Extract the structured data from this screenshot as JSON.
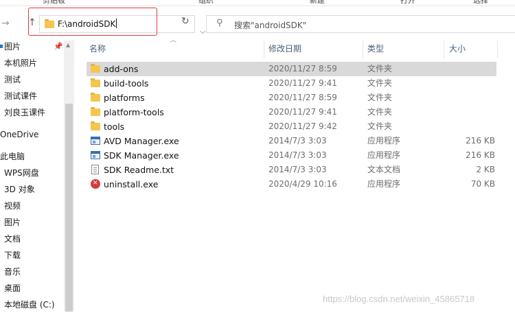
{
  "ribbon": {
    "items": [
      "剪贴板",
      "组织",
      "新建",
      "打开",
      "选择"
    ]
  },
  "nav": {
    "back": "→",
    "up": "↑"
  },
  "address": {
    "path": "F:\\androidSDK"
  },
  "search": {
    "placeholder": "搜索\"androidSDK\""
  },
  "sidebar": {
    "items": [
      {
        "label": "图片",
        "pinned": true
      },
      {
        "label": "本机照片"
      },
      {
        "label": "测试"
      },
      {
        "label": "测试课件"
      },
      {
        "label": "刘良玉课件"
      },
      {
        "label": "OneDrive"
      },
      {
        "label": "此电脑"
      },
      {
        "label": "WPS网盘"
      },
      {
        "label": "3D 对象"
      },
      {
        "label": "视频"
      },
      {
        "label": "图片"
      },
      {
        "label": "文档"
      },
      {
        "label": "下载"
      },
      {
        "label": "音乐"
      },
      {
        "label": "桌面"
      },
      {
        "label": "本地磁盘 (C:)"
      }
    ]
  },
  "columns": {
    "name": "名称",
    "date": "修改日期",
    "type": "类型",
    "size": "大小"
  },
  "files": [
    {
      "name": "add-ons",
      "date": "2020/11/27 8:59",
      "type": "文件夹",
      "size": "",
      "icon": "folder",
      "selected": true
    },
    {
      "name": "build-tools",
      "date": "2020/11/27 9:41",
      "type": "文件夹",
      "size": "",
      "icon": "folder"
    },
    {
      "name": "platforms",
      "date": "2020/11/27 8:59",
      "type": "文件夹",
      "size": "",
      "icon": "folder"
    },
    {
      "name": "platform-tools",
      "date": "2020/11/27 9:41",
      "type": "文件夹",
      "size": "",
      "icon": "folder"
    },
    {
      "name": "tools",
      "date": "2020/11/27 9:42",
      "type": "文件夹",
      "size": "",
      "icon": "folder"
    },
    {
      "name": "AVD Manager.exe",
      "date": "2014/7/3 3:03",
      "type": "应用程序",
      "size": "216 KB",
      "icon": "exe"
    },
    {
      "name": "SDK Manager.exe",
      "date": "2014/7/3 3:03",
      "type": "应用程序",
      "size": "216 KB",
      "icon": "exe"
    },
    {
      "name": "SDK Readme.txt",
      "date": "2014/7/3 3:03",
      "type": "文本文档",
      "size": "2 KB",
      "icon": "txt"
    },
    {
      "name": "uninstall.exe",
      "date": "2020/4/29 10:16",
      "type": "应用程序",
      "size": "70 KB",
      "icon": "uninstall"
    }
  ],
  "watermark": "https://blog.csdn.net/weixin_45865718"
}
